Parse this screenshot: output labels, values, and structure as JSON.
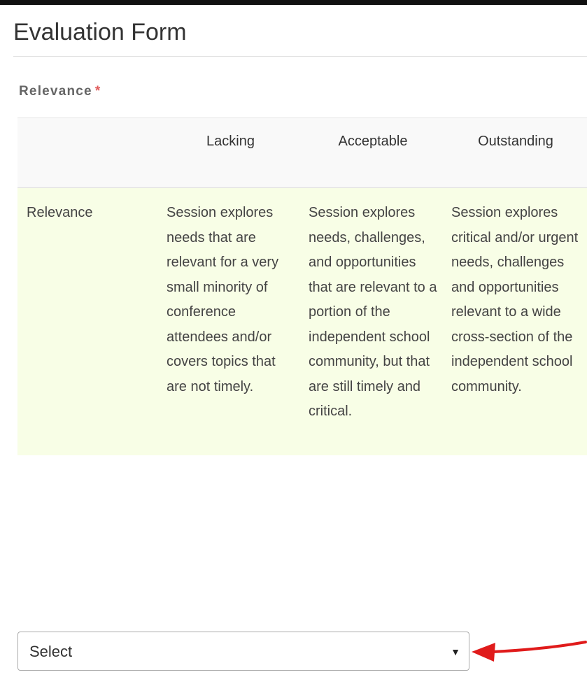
{
  "form": {
    "title": "Evaluation Form"
  },
  "field": {
    "label": "Relevance",
    "required_marker": "*"
  },
  "rubric": {
    "headers": [
      "",
      "Lacking",
      "Acceptable",
      "Outstanding"
    ],
    "row": {
      "label": "Relevance",
      "cells": [
        "Session explores needs that are relevant for a very small minority of conference attendees and/or covers topics that are not timely.",
        "Session explores needs, challenges, and opportunities that are relevant to a portion of the independent school community, but that are still timely and critical.",
        "Session explores critical and/or urgent needs, challenges and opportunities relevant to a wide cross-section of the independent school community."
      ]
    }
  },
  "select": {
    "value": "Select",
    "caret_icon": "caret-down-icon"
  },
  "annotation": {
    "icon": "red-arrow-icon",
    "color": "#e01b1b"
  },
  "colors": {
    "row_background": "#f8fee6",
    "required": "#e05a5a"
  }
}
